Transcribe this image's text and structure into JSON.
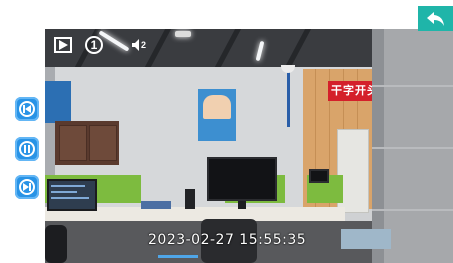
{
  "overlay": {
    "timestamp": "2023-02-27  15:55:35",
    "channel_number": "1",
    "volume_level": "2",
    "sign_text": "干字开头"
  },
  "icons": {
    "play": "play-icon",
    "channel": "channel-icon",
    "speaker": "speaker-icon",
    "back": "back-arrow-icon",
    "side_buttons": [
      "previous-icon",
      "pause-icon",
      "next-icon"
    ]
  },
  "colors": {
    "accent_teal": "#1fb5a9",
    "side_button_blue": "#2893e6",
    "progress_blue": "#4fa6e8"
  },
  "progress": {
    "fraction": 0.1
  }
}
